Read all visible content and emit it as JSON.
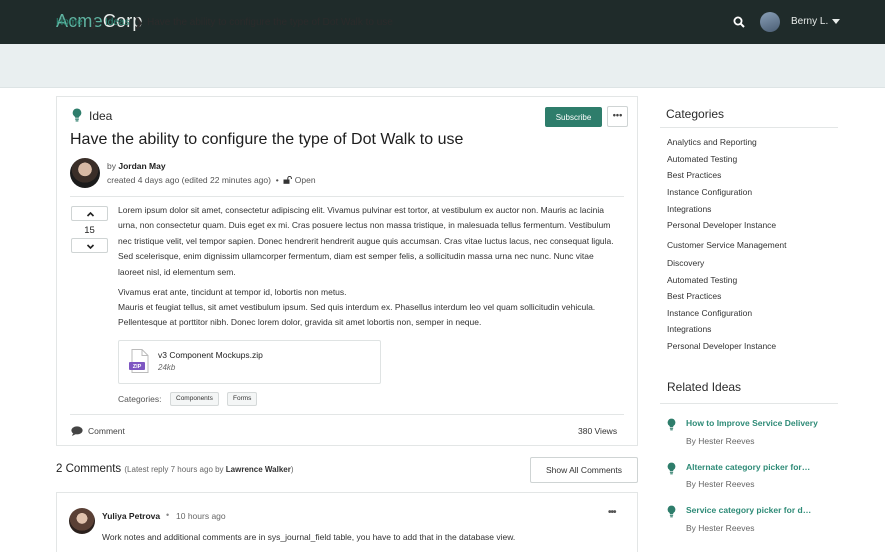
{
  "brand": {
    "part1": "Acme",
    "part2": "Corp"
  },
  "topbar": {
    "user": "Berny L."
  },
  "breadcrumb": {
    "home": "Home",
    "ideas": "Ideas",
    "current": "Have the ability to configure the type of Dot Walk to use",
    "separator": "❯"
  },
  "idea": {
    "type_label": "Idea",
    "subscribe_label": "Subscribe",
    "more_label": "•••",
    "title": "Have the ability to configure the type of Dot Walk to use",
    "by_prefix": "by",
    "author": "Jordan May",
    "created": "created 4 days ago (edited 22 minutes ago)",
    "bullet": "•",
    "status": "Open",
    "votes": "15",
    "body": [
      "Lorem ipsum dolor sit amet, consectetur adipiscing elit. Vivamus pulvinar est tortor, at vestibulum ex auctor non. Mauris ac lacinia urna, non consectetur quam. Duis eget ex mi. Cras posuere lectus non massa tristique, in malesuada tellus fermentum. Vestibulum nec tristique velit, vel tempor sapien. Donec hendrerit hendrerit augue quis accumsan. Cras vitae luctus lacus, nec consequat ligula. Sed scelerisque, enim dignissim ullamcorper fermentum, diam est semper felis, a sollicitudin massa urna nec nunc. Nunc vitae laoreet nisl, id elementum sem.",
      "Vivamus erat ante, tincidunt at tempor id, lobortis non metus.",
      "Mauris et feugiat tellus, sit amet vestibulum ipsum. Sed quis interdum ex. Phasellus interdum leo vel quam sollicitudin vehicula. Pellentesque at porttitor nibh. Donec lorem dolor, gravida sit amet lobortis non, semper in neque."
    ],
    "attachment": {
      "name": "v3 Component Mockups.zip",
      "size": "24kb",
      "badge": "ZIP"
    },
    "categories_label": "Categories:",
    "tags": [
      "Components",
      "Forms"
    ],
    "comment_label": "Comment",
    "views": "380  Views"
  },
  "comments": {
    "heading": "2 Comments",
    "latest_prefix": "(Latest reply 7 hours ago by ",
    "latest_author": "Lawrence Walker",
    "latest_suffix": ")",
    "show_all": "Show All Comments",
    "first": {
      "name": "Yuliya Petrova",
      "bullet": "•",
      "time": "10 hours ago",
      "more": "•••",
      "text": "Work notes and additional comments are in sys_journal_field table, you have to add that in the database view."
    }
  },
  "sidebar": {
    "categories_title": "Categories",
    "categories": [
      "Analytics and Reporting",
      "Automated Testing",
      "Best Practices",
      "Instance Configuration",
      "Integrations",
      "Personal Developer Instance",
      "Customer Service Management",
      "Discovery",
      "Automated Testing",
      "Best Practices",
      "Instance Configuration",
      "Integrations",
      "Personal Developer Instance"
    ],
    "related_title": "Related Ideas",
    "related": [
      {
        "title": "How to Improve Service Delivery",
        "by": "By Hester Reeves"
      },
      {
        "title": "Alternate category picker for…",
        "by": "By Hester Reeves"
      },
      {
        "title": "Service category picker for d…",
        "by": "By Hester Reeves"
      }
    ]
  },
  "colors": {
    "accent": "#2e7d6b",
    "link": "#2e8b77",
    "topbar": "#1f2b2a",
    "crumbbar": "#e9eff0"
  }
}
